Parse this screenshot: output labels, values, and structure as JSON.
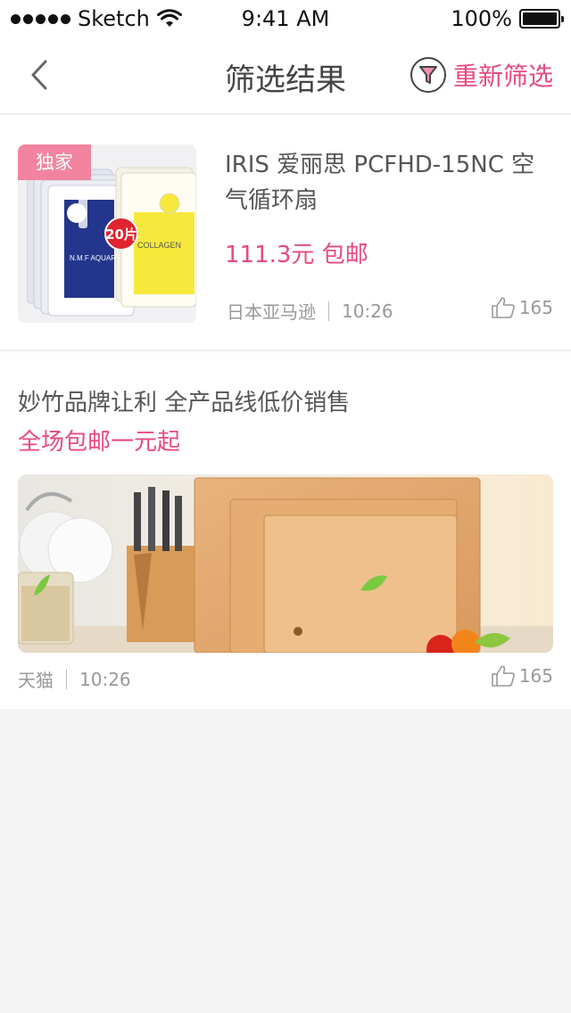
{
  "status_bar": {
    "carrier": "Sketch",
    "time": "9:41 AM",
    "battery": "100%"
  },
  "nav": {
    "title": "筛选结果",
    "refilter_label": "重新筛选",
    "back_icon": "chevron-left-icon",
    "refilter_icon": "funnel-icon"
  },
  "items": [
    {
      "tag": "独家",
      "badge": "20片",
      "product_text_1": "N.M.F AQUARING",
      "product_text_2": "COLLAGEN",
      "title": "IRIS 爱丽思 PCFHD-15NC 空气循环扇",
      "price": "111.3元 包邮",
      "source": "日本亚马逊",
      "time": "10:26",
      "likes": "165"
    },
    {
      "title": "妙竹品牌让利 全产品线低价销售",
      "subtitle": "全场包邮一元起",
      "source": "天猫",
      "time": "10:26",
      "likes": "165"
    }
  ],
  "colors": {
    "accent": "#e84a7f",
    "tag_bg": "#f2839f",
    "text": "#555555",
    "muted": "#999999",
    "background": "#f4f4f4"
  }
}
